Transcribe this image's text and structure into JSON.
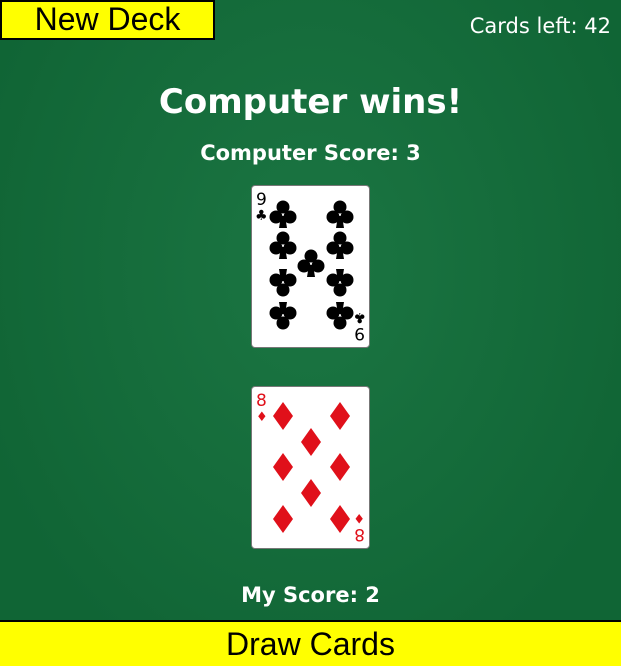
{
  "toolbar": {
    "new_deck_label": "New Deck",
    "cards_left": "Cards left: 42"
  },
  "result_text": "Computer wins!",
  "computer_score": "Computer Score: 3",
  "my_score": "My Score: 2",
  "draw_button_label": "Draw Cards",
  "colors": {
    "felt": "#12703b",
    "button": "#ffff00",
    "black_suit": "#000000",
    "red_suit": "#e0101a"
  },
  "computer_card": {
    "rank": "9",
    "suit": "clubs",
    "suit_symbol": "♣",
    "color": "#000000"
  },
  "player_card": {
    "rank": "8",
    "suit": "diamonds",
    "suit_symbol": "♦",
    "color": "#e0101a"
  }
}
